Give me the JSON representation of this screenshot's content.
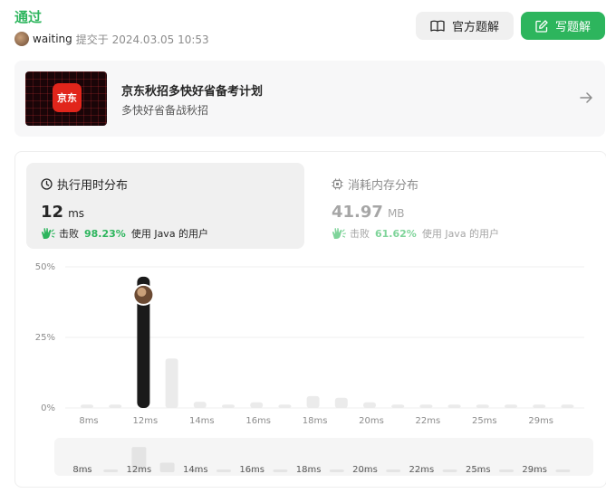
{
  "header": {
    "status": "通过",
    "username": "waiting",
    "submitted_text": "提交于 2024.03.05 10:53"
  },
  "buttons": {
    "solution_label": "官方题解",
    "write_label": "写题解"
  },
  "promo": {
    "logo_text": "京东",
    "title": "京东秋招多快好省备考计划",
    "subtitle": "多快好省备战秋招"
  },
  "runtime": {
    "title": "执行用时分布",
    "value": "12",
    "unit": "ms",
    "beats_prefix": "击败",
    "beats_pct": "98.23%",
    "beats_suffix": "使用 Java 的用户"
  },
  "memory": {
    "title": "消耗内存分布",
    "value": "41.97",
    "unit": "MB",
    "beats_prefix": "击败",
    "beats_pct": "61.62%",
    "beats_suffix": "使用 Java 的用户"
  },
  "colors": {
    "accent_green": "#2db55d",
    "light_green": "#7fd49a",
    "bar_selected": "#1a1a1a",
    "bar_default": "#ebebeb"
  },
  "chart_data": {
    "type": "bar",
    "y_unit": "percent",
    "ylim": [
      0,
      50
    ],
    "y_ticks": [
      "50%",
      "25%",
      "0%"
    ],
    "x_tick_labels": [
      "8ms",
      "12ms",
      "14ms",
      "16ms",
      "18ms",
      "20ms",
      "22ms",
      "25ms",
      "29ms"
    ],
    "x_tick_bar_index": [
      0,
      2,
      4,
      6,
      8,
      10,
      12,
      14,
      16
    ],
    "values": [
      1.2,
      1.2,
      46.5,
      17.5,
      2.2,
      1.2,
      2.0,
      1.2,
      4.2,
      3.6,
      2.0,
      1.2,
      1.2,
      1.2,
      1.2,
      1.2,
      1.2,
      1.2
    ],
    "highlight_index": 2,
    "highlight_color": "#1a1a1a",
    "bar_color": "#ebebeb",
    "grid": true
  }
}
